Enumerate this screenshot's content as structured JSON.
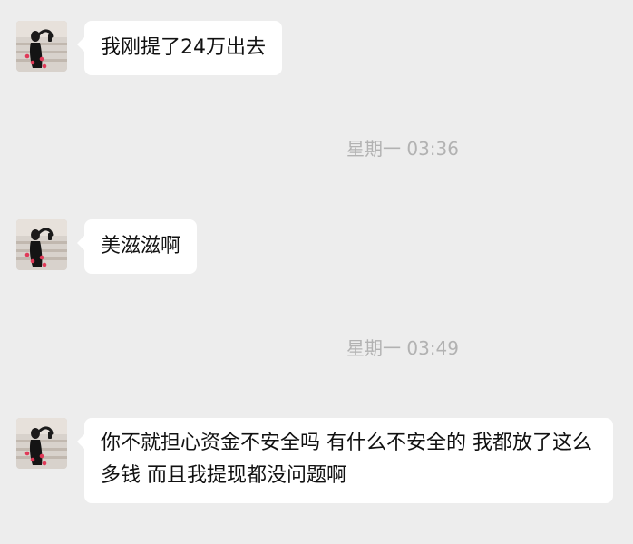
{
  "messages": [
    {
      "sender": "other",
      "text": "我刚提了24万出去"
    },
    {
      "timestamp": "星期一 03:36"
    },
    {
      "sender": "other",
      "text": "美滋滋啊"
    },
    {
      "timestamp": "星期一 03:49"
    },
    {
      "sender": "other",
      "text": "你不就担心资金不安全吗   有什么不安全的  我都放了这么多钱  而且我提现都没问题啊"
    }
  ],
  "colors": {
    "background": "#ededed",
    "bubble": "#ffffff",
    "timestamp": "#b2b2b2",
    "text": "#111111"
  }
}
